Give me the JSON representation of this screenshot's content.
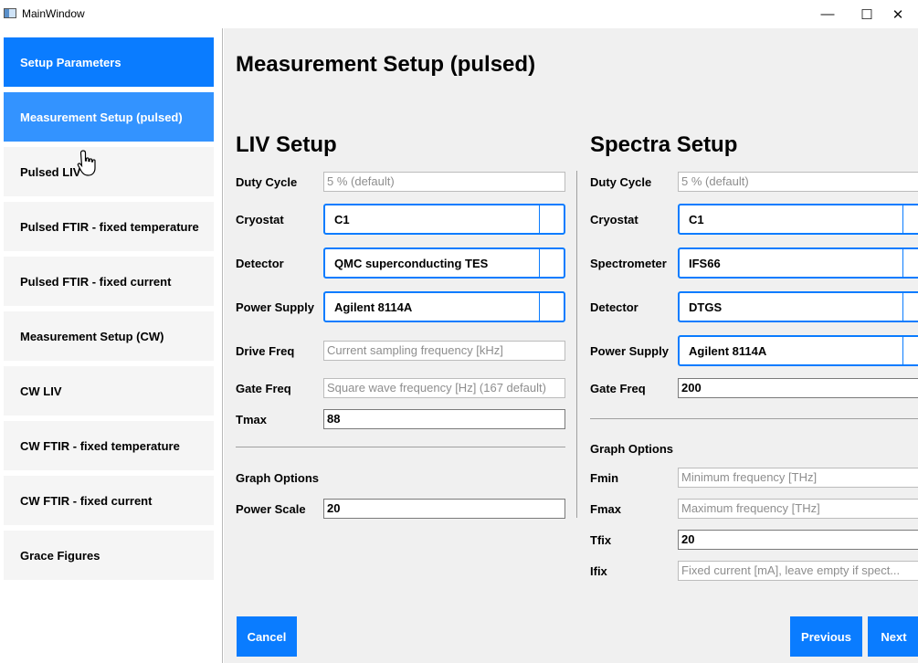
{
  "window": {
    "title": "MainWindow",
    "minimize": "—",
    "maximize": "☐",
    "close": "✕"
  },
  "sidebar": {
    "items": [
      {
        "label": "Setup Parameters"
      },
      {
        "label": "Measurement Setup (pulsed)"
      },
      {
        "label": "Pulsed LIV"
      },
      {
        "label": "Pulsed FTIR - fixed temperature"
      },
      {
        "label": "Pulsed FTIR - fixed current"
      },
      {
        "label": "Measurement Setup (CW)"
      },
      {
        "label": "CW LIV"
      },
      {
        "label": "CW FTIR - fixed temperature"
      },
      {
        "label": "CW FTIR - fixed current"
      },
      {
        "label": "Grace Figures"
      }
    ]
  },
  "page": {
    "title": "Measurement Setup (pulsed)"
  },
  "liv": {
    "title": "LIV Setup",
    "duty_cycle": {
      "label": "Duty Cycle",
      "placeholder": "5 % (default)"
    },
    "cryostat": {
      "label": "Cryostat",
      "value": "C1"
    },
    "detector": {
      "label": "Detector",
      "value": "QMC superconducting TES"
    },
    "power_supply": {
      "label": "Power Supply",
      "value": "Agilent 8114A"
    },
    "drive_freq": {
      "label": "Drive Freq",
      "placeholder": "Current sampling frequency [kHz]"
    },
    "gate_freq": {
      "label": "Gate Freq",
      "placeholder": "Square wave frequency [Hz] (167 default)"
    },
    "tmax": {
      "label": "Tmax",
      "value": "88"
    },
    "graph_options": "Graph Options",
    "power_scale": {
      "label": "Power Scale",
      "value": "20"
    }
  },
  "spectra": {
    "title": "Spectra Setup",
    "duty_cycle": {
      "label": "Duty Cycle",
      "placeholder": "5 % (default)"
    },
    "cryostat": {
      "label": "Cryostat",
      "value": "C1"
    },
    "spectrometer": {
      "label": "Spectrometer",
      "value": "IFS66"
    },
    "detector": {
      "label": "Detector",
      "value": "DTGS"
    },
    "power_supply": {
      "label": "Power Supply",
      "value": "Agilent 8114A"
    },
    "gate_freq": {
      "label": "Gate Freq",
      "value": "200"
    },
    "graph_options": "Graph Options",
    "fmin": {
      "label": "Fmin",
      "placeholder": "Minimum frequency [THz]"
    },
    "fmax": {
      "label": "Fmax",
      "placeholder": "Maximum frequency [THz]"
    },
    "tfix": {
      "label": "Tfix",
      "value": "20"
    },
    "ifix": {
      "label": "Ifix",
      "placeholder": "Fixed current [mA], leave empty if spect..."
    }
  },
  "buttons": {
    "cancel": "Cancel",
    "previous": "Previous",
    "next": "Next"
  },
  "colors": {
    "accent": "#0a7cff",
    "active": "#3393ff",
    "panel": "#f0f0f0"
  }
}
